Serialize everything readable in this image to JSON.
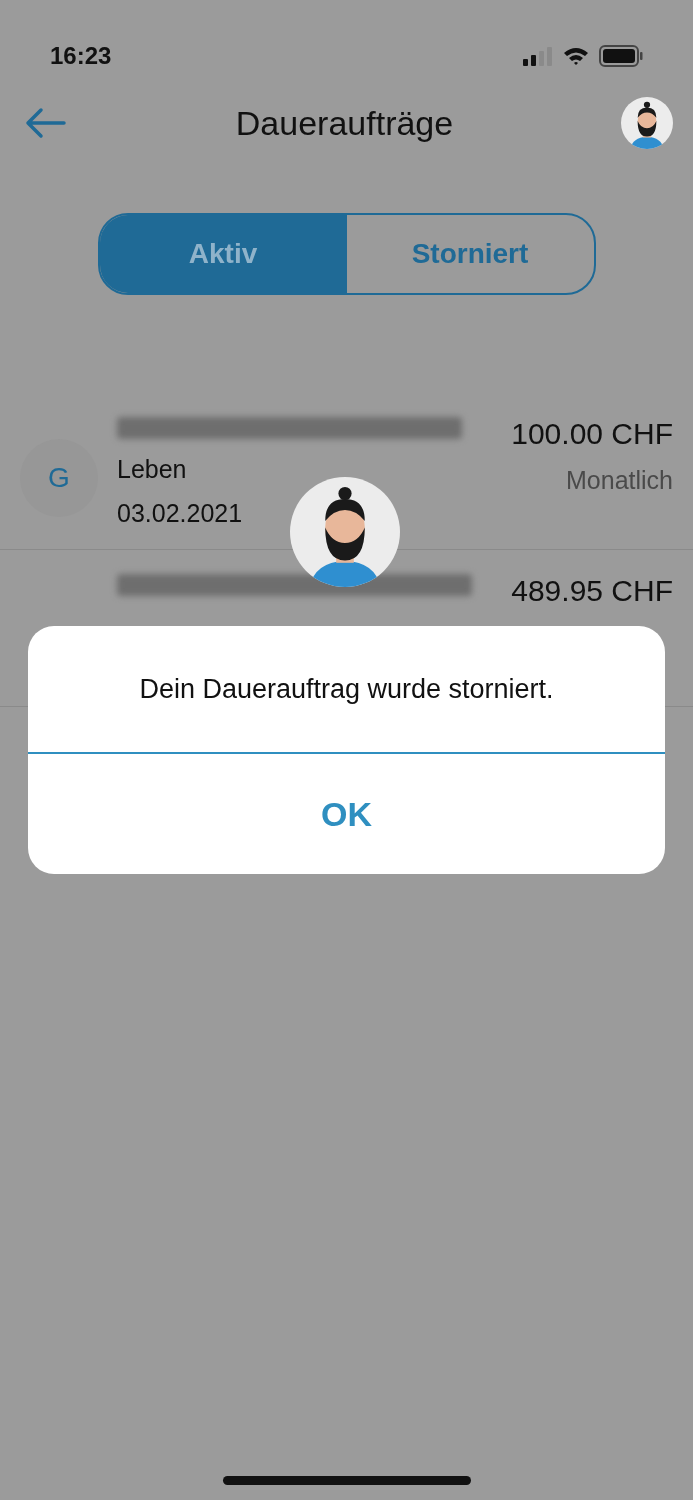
{
  "status_bar": {
    "time": "16:23"
  },
  "header": {
    "title": "Daueraufträge"
  },
  "tabs": [
    {
      "label": "Aktiv",
      "selected": true
    },
    {
      "label": "Storniert",
      "selected": false
    }
  ],
  "orders": [
    {
      "initial": "G",
      "amount": "100.00 CHF",
      "category": "Leben",
      "date": "03.02.2021",
      "frequency": "Monatlich"
    },
    {
      "amount": "489.95 CHF"
    }
  ],
  "dialog": {
    "message": "Dein Dauerauftrag wurde storniert.",
    "button": "OK"
  }
}
